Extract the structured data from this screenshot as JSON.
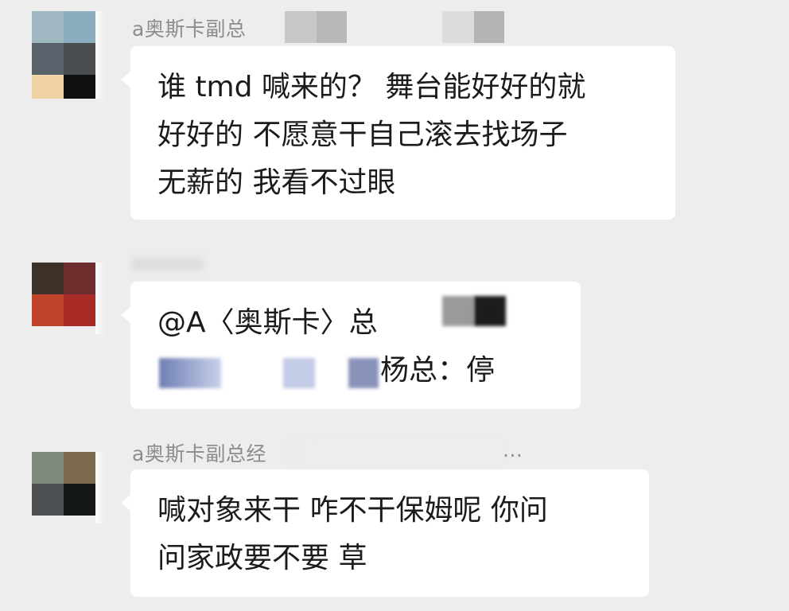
{
  "messages": [
    {
      "sender": "a奥斯卡副总",
      "lines": [
        "谁 tmd 喊来的？ 舞台能好好的就",
        "好好的 不愿意干自己滚去找场子",
        "无薪的 我看不过眼"
      ],
      "avatar_colors": [
        "#9fb8c2",
        "#8aaebd",
        "#59626a",
        "#4a4d50",
        "#f0d3a3",
        "#0f1010"
      ]
    },
    {
      "sender": "",
      "lines": [
        "@A〈奥斯卡〉总",
        "杨总：停"
      ],
      "avatar_colors": [
        "#3c3028",
        "#6e2e2e",
        "#c0442a",
        "#a82a26"
      ]
    },
    {
      "sender": "a奥斯卡副总经",
      "sender_suffix": "...",
      "lines": [
        "喊对象来干 咋不干保姆呢 你问",
        "问家政要不要 草"
      ],
      "avatar_colors": [
        "#7e8a7e",
        "#7b6a4e",
        "#4b4f52",
        "#151818"
      ]
    }
  ]
}
